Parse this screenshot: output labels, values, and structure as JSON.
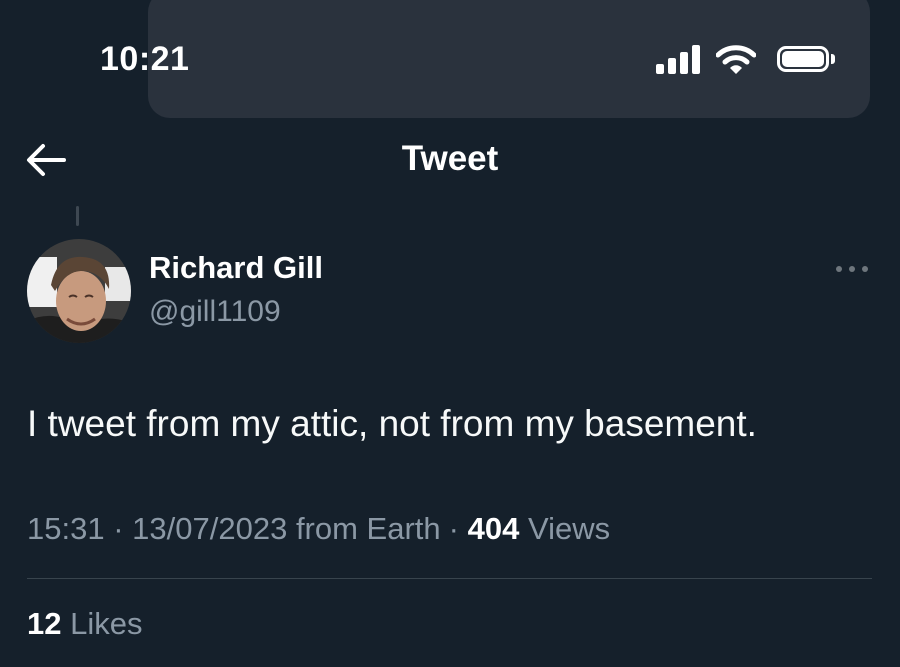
{
  "status_bar": {
    "time": "10:21",
    "icons": [
      "cellular-signal-icon",
      "wifi-icon",
      "battery-icon"
    ]
  },
  "header": {
    "title": "Tweet",
    "back_icon": "back-arrow-icon"
  },
  "tweet": {
    "author": {
      "display_name": "Richard Gill",
      "handle": "@gill1109"
    },
    "more_icon": "more-options-icon",
    "text": "I tweet from my attic, not from my basement.",
    "time": "15:31",
    "separator": "·",
    "date": "13/07/2023",
    "source": "from Earth",
    "views_count": "404",
    "views_label": "Views",
    "likes_count": "12",
    "likes_label": "Likes"
  },
  "colors": {
    "background": "#15202b",
    "text_primary": "#ffffff",
    "text_secondary": "#8b98a5",
    "divider": "#38444d"
  }
}
